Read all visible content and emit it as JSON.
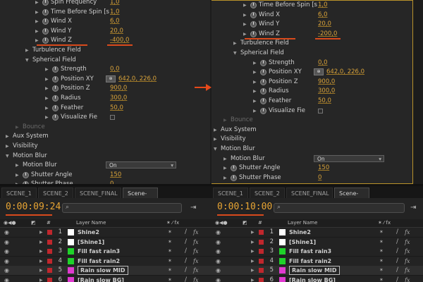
{
  "left": {
    "effect_rows": [
      {
        "label": "Spin Frequency",
        "value": "1,0",
        "indent": 1,
        "type": "prop"
      },
      {
        "label": "Time Before Spin [s",
        "value": "1,0",
        "indent": 1,
        "type": "prop"
      },
      {
        "label": "Wind X",
        "value": "6,0",
        "indent": 1,
        "type": "prop"
      },
      {
        "label": "Wind Y",
        "value": "20,0",
        "indent": 1,
        "type": "prop"
      },
      {
        "label": "Wind Z",
        "value": "-400,0",
        "indent": 1,
        "type": "prop",
        "highlight": true
      },
      {
        "label": "Turbulence Field",
        "indent": 0,
        "type": "group"
      },
      {
        "label": "Spherical Field",
        "indent": 0,
        "type": "group-open"
      },
      {
        "label": "Strength",
        "value": "0,0",
        "indent": 2,
        "type": "prop"
      },
      {
        "label": "Position XY",
        "value": "642,0, 226,0",
        "indent": 2,
        "type": "point"
      },
      {
        "label": "Position Z",
        "value": "900,0",
        "indent": 2,
        "type": "prop"
      },
      {
        "label": "Radius",
        "value": "300,0",
        "indent": 2,
        "type": "prop"
      },
      {
        "label": "Feather",
        "value": "50,0",
        "indent": 2,
        "type": "prop"
      },
      {
        "label": "Visualize Fie",
        "indent": 2,
        "type": "check"
      },
      {
        "label": "Bounce",
        "indent": -1,
        "type": "dim"
      },
      {
        "label": "Aux System",
        "indent": -2,
        "type": "group"
      },
      {
        "label": "Visibility",
        "indent": -2,
        "type": "group"
      },
      {
        "label": "Motion Blur",
        "indent": -2,
        "type": "group-open"
      },
      {
        "label": "Motion Blur",
        "value": "On",
        "indent": -1,
        "type": "dropdown"
      },
      {
        "label": "Shutter Angle",
        "value": "150",
        "indent": -1,
        "type": "prop"
      },
      {
        "label": "Shutter Phase",
        "value": "0",
        "indent": -1,
        "type": "prop"
      }
    ],
    "tabs": [
      "SCENE_1",
      "SCENE_2",
      "SCENE_FINAL",
      "Scene-1"
    ],
    "active_tab": 3,
    "timecode": "0:00:09:24",
    "layers_header": {
      "layer_name": "Layer Name",
      "hash": "#"
    },
    "layers": [
      {
        "num": "1",
        "name": "Shine2",
        "color": "#ffffff"
      },
      {
        "num": "2",
        "name": "[Shine1]",
        "color": "#ffffff"
      },
      {
        "num": "3",
        "name": "Fill fast rain3",
        "color": "#1fd22a"
      },
      {
        "num": "4",
        "name": "Fill fast rain2",
        "color": "#1fd22a"
      },
      {
        "num": "5",
        "name": "Rain slow MID",
        "color": "#e03ad0",
        "selected": true
      },
      {
        "num": "6",
        "name": "[Rain slow BG]",
        "color": "#e03ad0"
      }
    ]
  },
  "right": {
    "effect_rows": [
      {
        "label": "Time Before Spin [s",
        "value": "1,0",
        "indent": 1,
        "type": "prop"
      },
      {
        "label": "Wind X",
        "value": "6,0",
        "indent": 1,
        "type": "prop"
      },
      {
        "label": "Wind Y",
        "value": "20,0",
        "indent": 1,
        "type": "prop"
      },
      {
        "label": "Wind Z",
        "value": "-200,0",
        "indent": 1,
        "type": "prop",
        "highlight": true
      },
      {
        "label": "Turbulence Field",
        "indent": 0,
        "type": "group"
      },
      {
        "label": "Spherical Field",
        "indent": 0,
        "type": "group-open"
      },
      {
        "label": "Strength",
        "value": "0,0",
        "indent": 2,
        "type": "prop"
      },
      {
        "label": "Position XY",
        "value": "642,0, 226,0",
        "indent": 2,
        "type": "point"
      },
      {
        "label": "Position Z",
        "value": "900,0",
        "indent": 2,
        "type": "prop"
      },
      {
        "label": "Radius",
        "value": "300,0",
        "indent": 2,
        "type": "prop"
      },
      {
        "label": "Feather",
        "value": "50,0",
        "indent": 2,
        "type": "prop"
      },
      {
        "label": "Visualize Fie",
        "indent": 2,
        "type": "check"
      },
      {
        "label": "Bounce",
        "indent": -1,
        "type": "dim"
      },
      {
        "label": "Aux System",
        "indent": -2,
        "type": "group"
      },
      {
        "label": "Visibility",
        "indent": -2,
        "type": "group"
      },
      {
        "label": "Motion Blur",
        "indent": -2,
        "type": "group-open"
      },
      {
        "label": "Motion Blur",
        "value": "On",
        "indent": -1,
        "type": "dropdown"
      },
      {
        "label": "Shutter Angle",
        "value": "150",
        "indent": -1,
        "type": "prop"
      },
      {
        "label": "Shutter Phase",
        "value": "0",
        "indent": -1,
        "type": "prop"
      }
    ],
    "tabs": [
      "SCENE_1",
      "SCENE_2",
      "SCENE_FINAL",
      "Scene-1"
    ],
    "active_tab": 3,
    "timecode": "0:00:10:00",
    "layers_header": {
      "layer_name": "Layer Name",
      "hash": "#"
    },
    "layers": [
      {
        "num": "1",
        "name": "Shine2",
        "color": "#ffffff"
      },
      {
        "num": "2",
        "name": "[Shine1]",
        "color": "#ffffff"
      },
      {
        "num": "3",
        "name": "Fill fast rain3",
        "color": "#1fd22a"
      },
      {
        "num": "4",
        "name": "Fill fast rain2",
        "color": "#1fd22a"
      },
      {
        "num": "5",
        "name": "Rain slow MID",
        "color": "#e03ad0",
        "selected": true
      },
      {
        "num": "6",
        "name": "[Rain slow BG]",
        "color": "#e03ad0"
      }
    ]
  },
  "icons": {
    "stopwatch": "stopwatch-icon",
    "twirl": "twirl-triangle-icon",
    "eye": "eye-icon",
    "search": "search-icon",
    "fx": "fx-icon",
    "arrow": "right-arrow-icon"
  },
  "colors": {
    "value_orange": "#d8a23a",
    "highlight_red": "#d94a1c",
    "timecode_orange": "#e8a534",
    "label_red": "#c0272d"
  }
}
